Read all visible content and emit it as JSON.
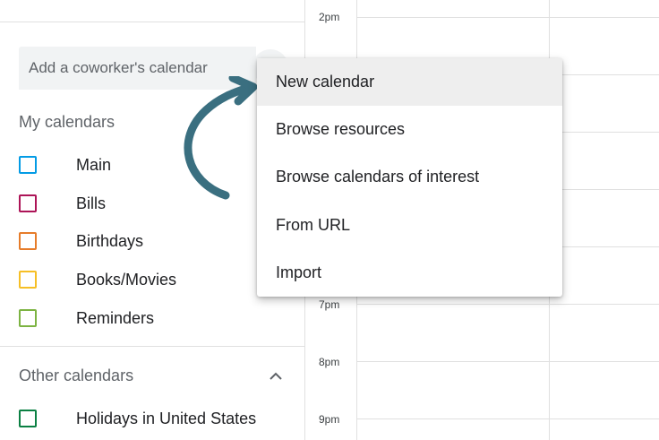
{
  "sidebar": {
    "coworker_placeholder": "Add a coworker's calendar",
    "my_calendars": {
      "title": "My calendars",
      "items": [
        {
          "label": "Main",
          "color": "#039be5"
        },
        {
          "label": "Bills",
          "color": "#ad1457"
        },
        {
          "label": "Birthdays",
          "color": "#e67c73"
        },
        {
          "label": "Books/Movies",
          "color": "#f6bf26"
        },
        {
          "label": "Reminders",
          "color": "#7cb342"
        }
      ]
    },
    "other_calendars": {
      "title": "Other calendars",
      "items": [
        {
          "label": "Holidays in United States",
          "color": "#0b8043"
        }
      ]
    }
  },
  "grid": {
    "times": [
      "2pm",
      "7pm",
      "8pm",
      "9pm"
    ]
  },
  "menu": {
    "items": [
      {
        "label": "New calendar",
        "active": true
      },
      {
        "label": "Browse resources",
        "active": false
      },
      {
        "label": "Browse calendars of interest",
        "active": false
      },
      {
        "label": "From URL",
        "active": false
      },
      {
        "label": "Import",
        "active": false
      }
    ]
  },
  "colors": {
    "arrow": "#3a6f80",
    "menu_highlight": "#eeeeee"
  }
}
